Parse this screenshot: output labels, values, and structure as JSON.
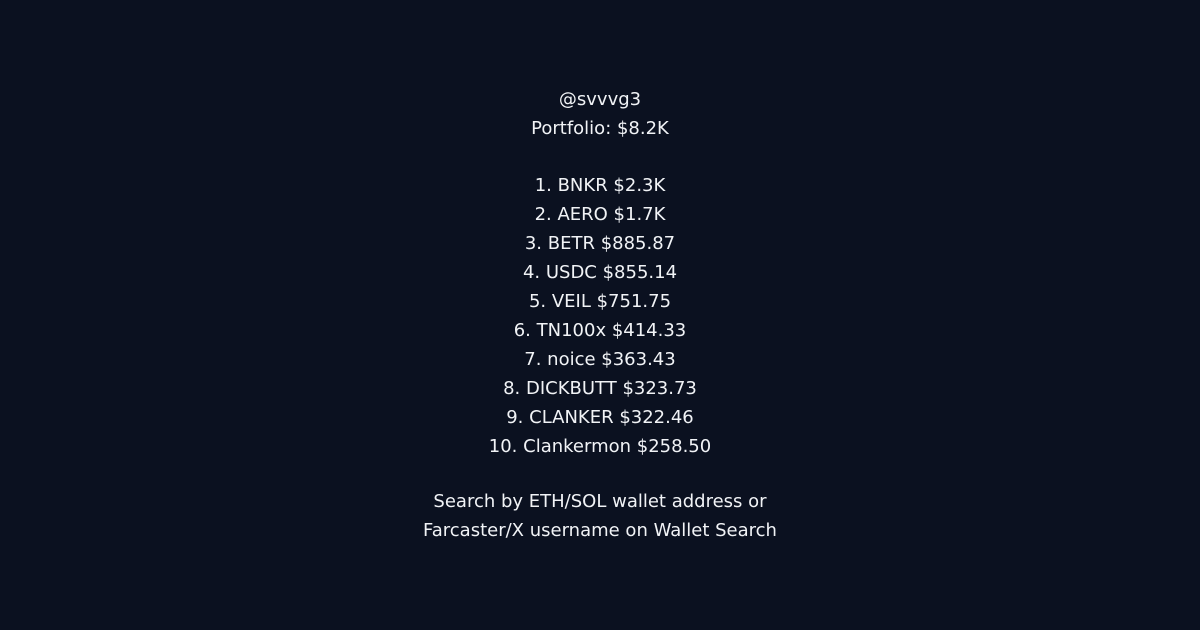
{
  "profile": {
    "username": "@svvvg3",
    "portfolio": "Portfolio: $8.2K"
  },
  "holdings": [
    "1. BNKR $2.3K",
    "2. AERO $1.7K",
    "3. BETR $885.87",
    "4. USDC $855.14",
    "5. VEIL $751.75",
    "6. TN100x $414.33",
    "7. noice $363.43",
    "8. DICKBUTT $323.73",
    "9. CLANKER $322.46",
    "10. Clankermon $258.50"
  ],
  "footer": {
    "line1": "Search by ETH/SOL wallet address or",
    "line2": "Farcaster/X username on Wallet Search"
  },
  "colors": {
    "background": "#0b1120",
    "text": "#f1f3f6"
  }
}
